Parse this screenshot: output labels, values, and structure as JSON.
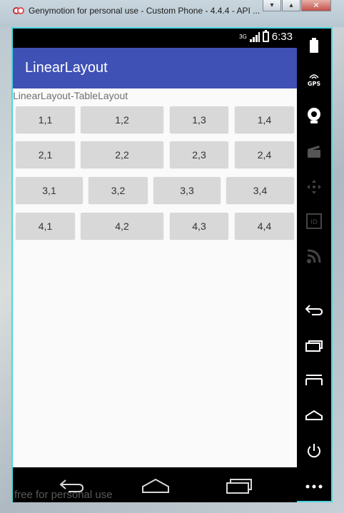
{
  "window": {
    "title": "Genymotion for personal use - Custom Phone - 4.4.4 - API ...",
    "minimize": "▾",
    "maximize": "▴",
    "close": "✕"
  },
  "status": {
    "network": "3G",
    "time": "6:33"
  },
  "app": {
    "title": "LinearLayout",
    "caption": "LinearLayout-TableLayout"
  },
  "grid": {
    "row1": [
      "1,1",
      "1,2",
      "1,3",
      "1,4"
    ],
    "row2": [
      "2,1",
      "2,2",
      "2,3",
      "2,4"
    ],
    "row3": [
      "3,1",
      "3,2",
      "3,3",
      "3,4"
    ],
    "row4": [
      "4,1",
      "4,2",
      "4,3",
      "4,4"
    ]
  },
  "toolbar": {
    "gps_label": "GPS",
    "id_label": "ID",
    "icons": [
      "battery-icon",
      "gps-icon",
      "camera-icon",
      "clapper-icon",
      "dpad-icon",
      "id-icon",
      "rss-icon",
      "back-icon",
      "recent-apps-icon",
      "menu-icon",
      "home-icon",
      "power-icon",
      "more-icon"
    ]
  },
  "nav": {
    "icons": [
      "back-icon",
      "home-icon",
      "recent-apps-icon"
    ]
  },
  "watermark": "free for personal use",
  "colors": {
    "appbar": "#3f51b5",
    "frame": "#4fd6df",
    "button": "#d8d8d8",
    "content_bg": "#fafafa"
  }
}
